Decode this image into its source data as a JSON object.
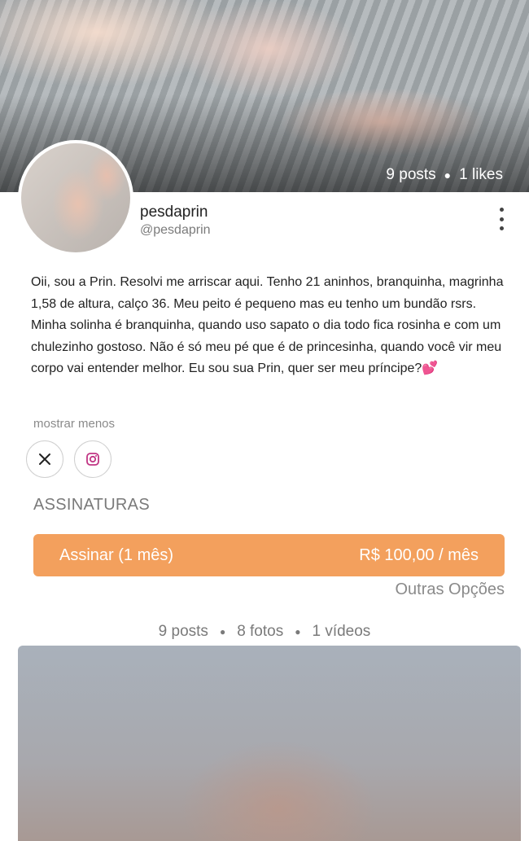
{
  "profile": {
    "posts_stat": "9 posts",
    "likes_stat": "1 likes",
    "name": "pesdaprin",
    "handle": "@pesdaprin",
    "bio": "Oii, sou a Prin. Resolvi me arriscar aqui. Tenho 21 aninhos, branquinha, magrinha 1,58 de altura, calço 36. Meu peito é pequeno mas eu tenho um bundão rsrs. Minha solinha é branquinha, quando uso sapato o dia todo fica rosinha e com um chulezinho gostoso. Não é só meu pé que é de princesinha, quando você vir meu corpo vai entender melhor. Eu sou sua Prin, quer ser meu príncipe?💕",
    "show_less": "mostrar menos"
  },
  "social": {
    "x_icon": "x-logo-icon",
    "instagram_icon": "instagram-icon",
    "instagram_color": "#c13584"
  },
  "subscriptions": {
    "title": "ASSINATURAS",
    "button_label": "Assinar (1 mês)",
    "button_price": "R$ 100,00 / mês",
    "other_options": "Outras Opções",
    "accent_color": "#f3a05d"
  },
  "content_counts": {
    "posts": "9 posts",
    "photos": "8 fotos",
    "videos": "1 vídeos"
  }
}
